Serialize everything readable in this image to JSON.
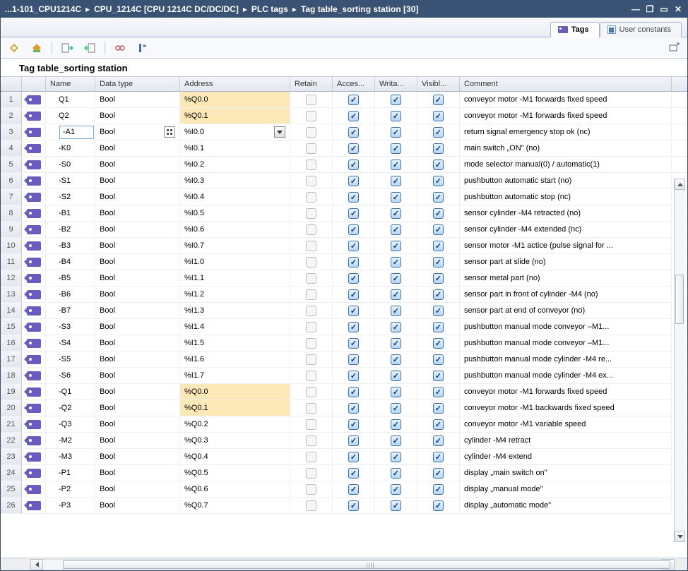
{
  "breadcrumb": {
    "parts": [
      "...1-101_CPU1214C",
      "CPU_1214C [CPU 1214C DC/DC/DC]",
      "PLC tags",
      "Tag table_sorting station [30]"
    ]
  },
  "tabs": {
    "tags": "Tags",
    "constants": "User constants"
  },
  "table_title": "Tag table_sorting station",
  "columns": {
    "rownum": "",
    "icon": "",
    "name": "Name",
    "datatype": "Data type",
    "address": "Address",
    "retain": "Retain",
    "access": "Acces...",
    "writa": "Writa...",
    "visibl": "Visibl...",
    "comment": "Comment"
  },
  "rows": [
    {
      "n": 1,
      "name": "Q1",
      "dtype": "Bool",
      "addr": "%Q0.0",
      "addr_hl": true,
      "retain": false,
      "a": true,
      "w": true,
      "v": true,
      "c": "conveyor motor -M1 forwards fixed speed"
    },
    {
      "n": 2,
      "name": "Q2",
      "dtype": "Bool",
      "addr": "%Q0.1",
      "addr_hl": true,
      "retain": false,
      "a": true,
      "w": true,
      "v": true,
      "c": "conveyor motor -M1 forwards fixed speed"
    },
    {
      "n": 3,
      "name": "-A1",
      "dtype": "Bool",
      "addr": "%I0.0",
      "addr_hl": false,
      "retain": false,
      "a": true,
      "w": true,
      "v": true,
      "c": "return signal emergency stop ok (nc)",
      "editing": true
    },
    {
      "n": 4,
      "name": "-K0",
      "dtype": "Bool",
      "addr": "%I0.1",
      "addr_hl": false,
      "retain": false,
      "a": true,
      "w": true,
      "v": true,
      "c": "main switch „ON\" (no)"
    },
    {
      "n": 5,
      "name": "-S0",
      "dtype": "Bool",
      "addr": "%I0.2",
      "addr_hl": false,
      "retain": false,
      "a": true,
      "w": true,
      "v": true,
      "c": "mode selector manual(0) / automatic(1)"
    },
    {
      "n": 6,
      "name": "-S1",
      "dtype": "Bool",
      "addr": "%I0.3",
      "addr_hl": false,
      "retain": false,
      "a": true,
      "w": true,
      "v": true,
      "c": "pushbutton automatic start (no)"
    },
    {
      "n": 7,
      "name": "-S2",
      "dtype": "Bool",
      "addr": "%I0.4",
      "addr_hl": false,
      "retain": false,
      "a": true,
      "w": true,
      "v": true,
      "c": "pushbutton automatic stop (nc)"
    },
    {
      "n": 8,
      "name": "-B1",
      "dtype": "Bool",
      "addr": "%I0.5",
      "addr_hl": false,
      "retain": false,
      "a": true,
      "w": true,
      "v": true,
      "c": "sensor cylinder -M4 retracted (no)"
    },
    {
      "n": 9,
      "name": "-B2",
      "dtype": "Bool",
      "addr": "%I0.6",
      "addr_hl": false,
      "retain": false,
      "a": true,
      "w": true,
      "v": true,
      "c": "sensor cylinder -M4 extended (nc)"
    },
    {
      "n": 10,
      "name": "-B3",
      "dtype": "Bool",
      "addr": "%I0.7",
      "addr_hl": false,
      "retain": false,
      "a": true,
      "w": true,
      "v": true,
      "c": "sensor motor -M1 actice (pulse signal for ..."
    },
    {
      "n": 11,
      "name": "-B4",
      "dtype": "Bool",
      "addr": "%I1.0",
      "addr_hl": false,
      "retain": false,
      "a": true,
      "w": true,
      "v": true,
      "c": "sensor part at slide (no)"
    },
    {
      "n": 12,
      "name": "-B5",
      "dtype": "Bool",
      "addr": "%I1.1",
      "addr_hl": false,
      "retain": false,
      "a": true,
      "w": true,
      "v": true,
      "c": "sensor metal part (no)"
    },
    {
      "n": 13,
      "name": "-B6",
      "dtype": "Bool",
      "addr": "%I1.2",
      "addr_hl": false,
      "retain": false,
      "a": true,
      "w": true,
      "v": true,
      "c": "sensor part in front of cylinder -M4 (no)"
    },
    {
      "n": 14,
      "name": "-B7",
      "dtype": "Bool",
      "addr": "%I1.3",
      "addr_hl": false,
      "retain": false,
      "a": true,
      "w": true,
      "v": true,
      "c": "sensor part at end of conveyor (no)"
    },
    {
      "n": 15,
      "name": "-S3",
      "dtype": "Bool",
      "addr": "%I1.4",
      "addr_hl": false,
      "retain": false,
      "a": true,
      "w": true,
      "v": true,
      "c": "pushbutton manual mode conveyor –M1..."
    },
    {
      "n": 16,
      "name": "-S4",
      "dtype": "Bool",
      "addr": "%I1.5",
      "addr_hl": false,
      "retain": false,
      "a": true,
      "w": true,
      "v": true,
      "c": "pushbutton manual mode conveyor –M1..."
    },
    {
      "n": 17,
      "name": "-S5",
      "dtype": "Bool",
      "addr": "%I1.6",
      "addr_hl": false,
      "retain": false,
      "a": true,
      "w": true,
      "v": true,
      "c": "pushbutton manual mode cylinder -M4 re..."
    },
    {
      "n": 18,
      "name": "-S6",
      "dtype": "Bool",
      "addr": "%I1.7",
      "addr_hl": false,
      "retain": false,
      "a": true,
      "w": true,
      "v": true,
      "c": "pushbutton manual mode cylinder -M4 ex..."
    },
    {
      "n": 19,
      "name": "-Q1",
      "dtype": "Bool",
      "addr": "%Q0.0",
      "addr_hl": true,
      "retain": false,
      "a": true,
      "w": true,
      "v": true,
      "c": "conveyor motor -M1 forwards fixed speed"
    },
    {
      "n": 20,
      "name": "-Q2",
      "dtype": "Bool",
      "addr": "%Q0.1",
      "addr_hl": true,
      "retain": false,
      "a": true,
      "w": true,
      "v": true,
      "c": "conveyor motor -M1 backwards fixed speed"
    },
    {
      "n": 21,
      "name": "-Q3",
      "dtype": "Bool",
      "addr": "%Q0.2",
      "addr_hl": false,
      "retain": false,
      "a": true,
      "w": true,
      "v": true,
      "c": "conveyor motor -M1 variable speed"
    },
    {
      "n": 22,
      "name": "-M2",
      "dtype": "Bool",
      "addr": "%Q0.3",
      "addr_hl": false,
      "retain": false,
      "a": true,
      "w": true,
      "v": true,
      "c": "cylinder -M4 retract"
    },
    {
      "n": 23,
      "name": "-M3",
      "dtype": "Bool",
      "addr": "%Q0.4",
      "addr_hl": false,
      "retain": false,
      "a": true,
      "w": true,
      "v": true,
      "c": "cylinder -M4 extend"
    },
    {
      "n": 24,
      "name": "-P1",
      "dtype": "Bool",
      "addr": "%Q0.5",
      "addr_hl": false,
      "retain": false,
      "a": true,
      "w": true,
      "v": true,
      "c": "display „main switch on\""
    },
    {
      "n": 25,
      "name": "-P2",
      "dtype": "Bool",
      "addr": "%Q0.6",
      "addr_hl": false,
      "retain": false,
      "a": true,
      "w": true,
      "v": true,
      "c": "display „manual mode\""
    },
    {
      "n": 26,
      "name": "-P3",
      "dtype": "Bool",
      "addr": "%Q0.7",
      "addr_hl": false,
      "retain": false,
      "a": true,
      "w": true,
      "v": true,
      "c": "display „automatic mode\""
    }
  ]
}
